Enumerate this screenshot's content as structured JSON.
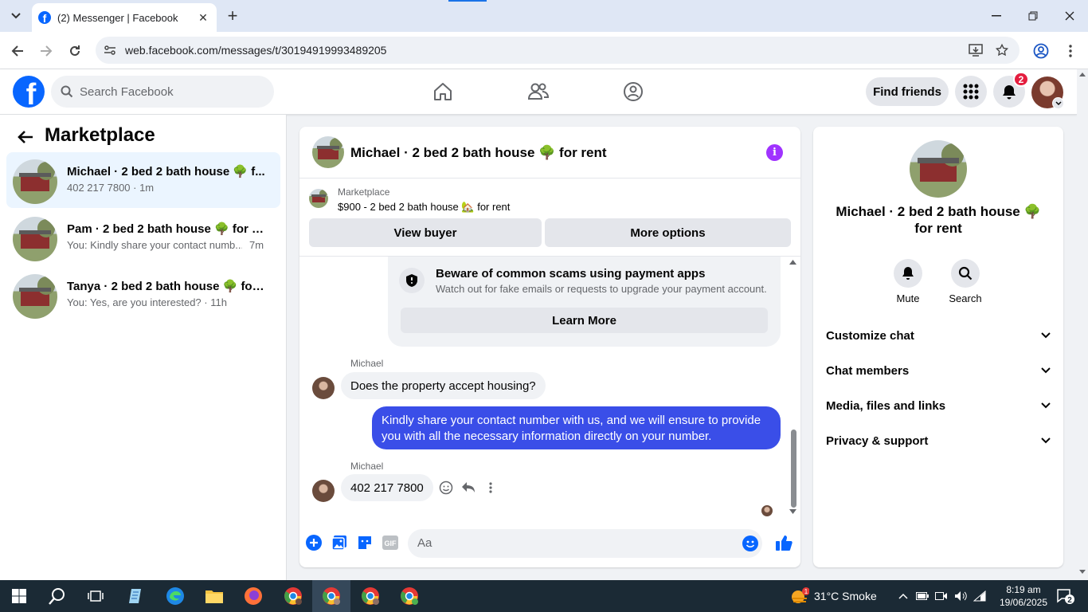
{
  "browser": {
    "tab_title": "(2) Messenger | Facebook",
    "url": "web.facebook.com/messages/t/30194919993489205"
  },
  "fb": {
    "search_placeholder": "Search Facebook",
    "find_friends": "Find friends",
    "notification_count": "2"
  },
  "left": {
    "title": "Marketplace",
    "conversations": [
      {
        "name": "Michael · 2 bed 2 bath house 🌳 f...",
        "preview": "402 217 7800 · 1m"
      },
      {
        "name": "Pam · 2 bed 2 bath house 🌳 for re...",
        "preview": "You: Kindly share your contact numb...",
        "time": "7m"
      },
      {
        "name": "Tanya · 2 bed 2 bath house 🌳 for ...",
        "preview": "You: Yes, are you interested? · 11h"
      }
    ]
  },
  "chat": {
    "title": "Michael · 2 bed 2 bath house 🌳 for rent",
    "marketplace_label": "Marketplace",
    "listing": "$900 - 2 bed 2 bath house 🏡 for rent",
    "view_buyer": "View buyer",
    "more_options": "More options",
    "scam_title": "Beware of common scams using payment apps",
    "scam_sub": "Watch out for fake emails or requests to upgrade your payment account.",
    "learn_more": "Learn More",
    "messages": [
      {
        "sender": "Michael",
        "text": "Does the property accept housing?"
      },
      {
        "sender": "me",
        "text": "Kindly share your contact number with us, and we will ensure to provide you with all the necessary information directly on your number."
      },
      {
        "sender": "Michael",
        "text": "402 217 7800"
      }
    ],
    "composer_placeholder": "Aa",
    "gif_label": "GIF"
  },
  "right": {
    "title": "Michael · 2 bed 2 bath house 🌳 for rent",
    "mute": "Mute",
    "search": "Search",
    "sections": [
      "Customize chat",
      "Chat members",
      "Media, files and links",
      "Privacy & support"
    ]
  },
  "taskbar": {
    "weather": "31°C  Smoke",
    "time": "8:19 am",
    "date": "19/06/2025",
    "notif_count": "2",
    "weather_alert": "1"
  },
  "colors": {
    "fb_blue": "#0866ff",
    "outgoing_bubble": "#3a4ee8",
    "info_purple": "#a033ff",
    "badge_red": "#e41e3f"
  }
}
